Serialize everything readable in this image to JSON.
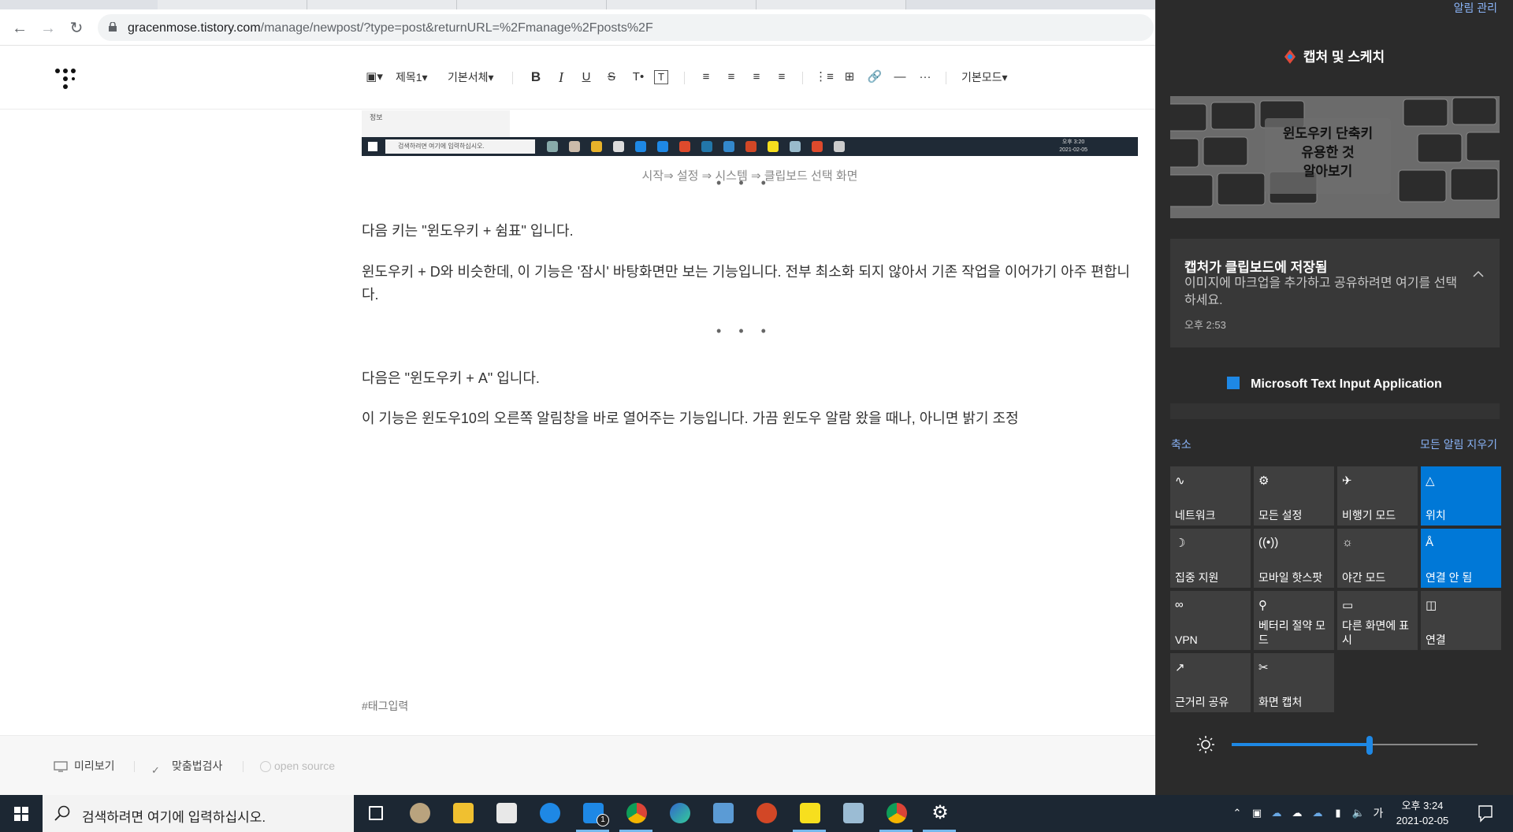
{
  "browser": {
    "url_host": "gracenmose.tistory.com",
    "url_path": "/manage/newpost/?type=post&returnURL=%2Fmanage%2Fposts%2F"
  },
  "toolbar": {
    "heading": "제목1",
    "font": "기본서체",
    "mode": "기본모드"
  },
  "content": {
    "img_label": "정보",
    "img_search": "검색하려면 여기에 입력하십시오.",
    "img_time": "오후 3:20",
    "img_date": "2021-02-05",
    "caption": "시작⇒ 설정 ⇒ 시스템 ⇒ 클립보드 선택 화면",
    "dots": "•••",
    "para1": "다음 키는 \"윈도우키 + 쉼표\" 입니다.",
    "para2": "윈도우키 + D와 비슷한데, 이 기능은 '잠시' 바탕화면만 보는 기능입니다. 전부 최소화 되지 않아서 기존 작업을 이어가기 아주 편합니다.",
    "para3": "다음은 \"윈도우키 + A\" 입니다.",
    "para4": "이 기능은 윈도우10의 오른쪽 알림창을 바로 열어주는 기능입니다. 가끔 윈도우 알람 왔을 때나, 아니면 밝기 조정",
    "tag_placeholder": "#태그입력"
  },
  "bottom_bar": {
    "preview": "미리보기",
    "spellcheck": "맞춤법검사",
    "open_source": "open source"
  },
  "action_center": {
    "manage": "알림 관리",
    "app_name": "캡처 및 스케치",
    "thumb_text": "윈도우키 단축키\n유용한 것\n알아보기",
    "notif_title": "캡처가 클립보드에 저장됨",
    "notif_body": "이미지에 마크업을 추가하고 공유하려면 여기를 선택하세요.",
    "notif_time": "오후 2:53",
    "mtia": "Microsoft Text Input Application",
    "collapse": "축소",
    "clear_all": "모든 알림 지우기",
    "tiles": [
      {
        "label": "네트워크",
        "on": false,
        "icon": "network-icon"
      },
      {
        "label": "모든 설정",
        "on": false,
        "icon": "gear-icon"
      },
      {
        "label": "비행기 모드",
        "on": false,
        "icon": "airplane-icon"
      },
      {
        "label": "위치",
        "on": true,
        "icon": "location-icon"
      },
      {
        "label": "집중 지원",
        "on": false,
        "icon": "moon-icon"
      },
      {
        "label": "모바일 핫스팟",
        "on": false,
        "icon": "hotspot-icon"
      },
      {
        "label": "야간 모드",
        "on": false,
        "icon": "sun-icon"
      },
      {
        "label": "연결 안 됨",
        "on": true,
        "icon": "bluetooth-icon"
      },
      {
        "label": "VPN",
        "on": false,
        "icon": "vpn-icon"
      },
      {
        "label": "베터리 절약 모드",
        "on": false,
        "icon": "battery-saver-icon"
      },
      {
        "label": "다른 화면에 표시",
        "on": false,
        "icon": "project-icon"
      },
      {
        "label": "연결",
        "on": false,
        "icon": "connect-icon"
      },
      {
        "label": "근거리 공유",
        "on": false,
        "icon": "nearby-share-icon"
      },
      {
        "label": "화면 캡처",
        "on": false,
        "icon": "screen-capture-icon"
      }
    ],
    "brightness": 0.56
  },
  "taskbar": {
    "search_placeholder": "검색하려면 여기에 입력하십시오.",
    "ime": "가",
    "time": "오후 3:24",
    "date": "2021-02-05",
    "mail_badge": "1"
  },
  "colors": {
    "accent_blue": "#0078d7",
    "action_center_bg": "#2b2b2b",
    "tile_bg": "#3f3f3f",
    "taskbar_bg": "#1c2733",
    "link_blue": "#8ab4f8"
  }
}
